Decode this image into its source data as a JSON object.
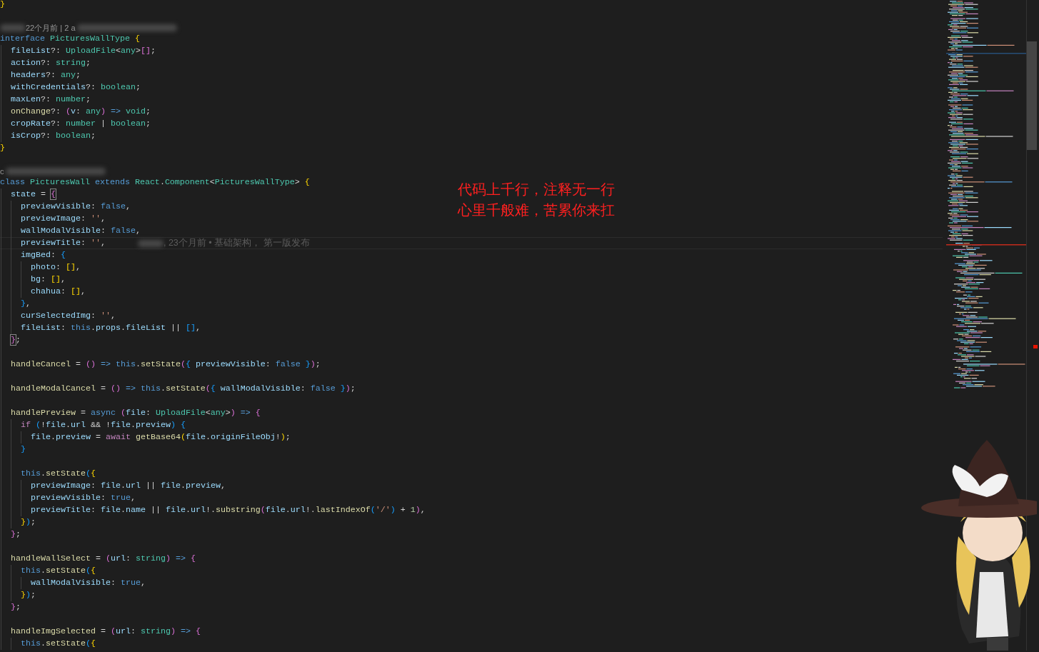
{
  "editor": {
    "lines": [
      {
        "kind": "code",
        "current": false,
        "tokens": [
          {
            "text": "}",
            "kind": "bracket1"
          }
        ]
      },
      {
        "kind": "blank",
        "current": false
      },
      {
        "kind": "lens",
        "segments": [
          {
            "kind": "shortblur"
          },
          {
            "kind": "text",
            "text": "22个月前 | 2 a"
          },
          {
            "kind": "longblur"
          }
        ]
      },
      {
        "kind": "code",
        "current": false,
        "tokens": [
          {
            "text": "interface ",
            "kind": "keyword"
          },
          {
            "text": "PicturesWallType ",
            "kind": "type"
          },
          {
            "text": "{",
            "kind": "bracket1"
          }
        ],
        "children": [
          {
            "kind": "code",
            "current": false,
            "tokens": [
              {
                "text": "fileList",
                "kind": "variable"
              },
              {
                "text": "?: ",
                "kind": "plain"
              },
              {
                "text": "UploadFile",
                "kind": "type"
              },
              {
                "text": "<",
                "kind": "plain"
              },
              {
                "text": "any",
                "kind": "type"
              },
              {
                "text": ">",
                "kind": "plain"
              },
              {
                "text": "[]",
                "kind": "bracket2"
              },
              {
                "text": ";",
                "kind": "plain"
              }
            ]
          },
          {
            "kind": "code",
            "current": false,
            "tokens": [
              {
                "text": "action",
                "kind": "variable"
              },
              {
                "text": "?: ",
                "kind": "plain"
              },
              {
                "text": "string",
                "kind": "type"
              },
              {
                "text": ";",
                "kind": "plain"
              }
            ]
          },
          {
            "kind": "code",
            "current": false,
            "tokens": [
              {
                "text": "headers",
                "kind": "variable"
              },
              {
                "text": "?: ",
                "kind": "plain"
              },
              {
                "text": "any",
                "kind": "type"
              },
              {
                "text": ";",
                "kind": "plain"
              }
            ]
          },
          {
            "kind": "code",
            "current": false,
            "tokens": [
              {
                "text": "withCredentials",
                "kind": "variable"
              },
              {
                "text": "?: ",
                "kind": "plain"
              },
              {
                "text": "boolean",
                "kind": "type"
              },
              {
                "text": ";",
                "kind": "plain"
              }
            ]
          },
          {
            "kind": "code",
            "current": false,
            "tokens": [
              {
                "text": "maxLen",
                "kind": "variable"
              },
              {
                "text": "?: ",
                "kind": "plain"
              },
              {
                "text": "number",
                "kind": "type"
              },
              {
                "text": ";",
                "kind": "plain"
              }
            ]
          },
          {
            "kind": "code",
            "current": false,
            "tokens": [
              {
                "text": "onChange",
                "kind": "function"
              },
              {
                "text": "?: ",
                "kind": "plain"
              },
              {
                "text": "(",
                "kind": "bracket2"
              },
              {
                "text": "v",
                "kind": "variable"
              },
              {
                "text": ": ",
                "kind": "plain"
              },
              {
                "text": "any",
                "kind": "type"
              },
              {
                "text": ")",
                "kind": "bracket2"
              },
              {
                "text": " => ",
                "kind": "keyword"
              },
              {
                "text": "void",
                "kind": "type"
              },
              {
                "text": ";",
                "kind": "plain"
              }
            ]
          },
          {
            "kind": "code",
            "current": false,
            "tokens": [
              {
                "text": "cropRate",
                "kind": "variable"
              },
              {
                "text": "?: ",
                "kind": "plain"
              },
              {
                "text": "number",
                "kind": "type"
              },
              {
                "text": " | ",
                "kind": "plain"
              },
              {
                "text": "boolean",
                "kind": "type"
              },
              {
                "text": ";",
                "kind": "plain"
              }
            ]
          },
          {
            "kind": "code",
            "current": false,
            "tokens": [
              {
                "text": "isCrop",
                "kind": "variable"
              },
              {
                "text": "?: ",
                "kind": "plain"
              },
              {
                "text": "boolean",
                "kind": "type"
              },
              {
                "text": ";",
                "kind": "plain"
              }
            ]
          }
        ]
      },
      {
        "kind": "code",
        "current": false,
        "tokens": [
          {
            "text": "}",
            "kind": "bracket1"
          }
        ]
      },
      {
        "kind": "blank",
        "current": false
      },
      {
        "kind": "lens",
        "segments": [
          {
            "kind": "text",
            "text": "c"
          },
          {
            "kind": "longblur"
          }
        ]
      },
      {
        "kind": "code",
        "current": false,
        "tokens": [
          {
            "text": "class ",
            "kind": "keyword"
          },
          {
            "text": "PicturesWall ",
            "kind": "type"
          },
          {
            "text": "extends ",
            "kind": "keyword"
          },
          {
            "text": "React",
            "kind": "type"
          },
          {
            "text": ".",
            "kind": "plain"
          },
          {
            "text": "Component",
            "kind": "type"
          },
          {
            "text": "<",
            "kind": "plain"
          },
          {
            "text": "PicturesWallType",
            "kind": "type"
          },
          {
            "text": "> ",
            "kind": "plain"
          },
          {
            "text": "{",
            "kind": "bracket1"
          }
        ],
        "children": [
          {
            "kind": "code",
            "current": false,
            "tokens": [
              {
                "text": "state",
                "kind": "variable"
              },
              {
                "text": " = ",
                "kind": "plain"
              },
              {
                "text": "{",
                "kind": "match"
              }
            ],
            "children": [
              {
                "kind": "code",
                "current": false,
                "tokens": [
                  {
                    "text": "previewVisible",
                    "kind": "variable"
                  },
                  {
                    "text": ": ",
                    "kind": "plain"
                  },
                  {
                    "text": "false",
                    "kind": "keyword"
                  },
                  {
                    "text": ",",
                    "kind": "plain"
                  }
                ]
              },
              {
                "kind": "code",
                "current": false,
                "tokens": [
                  {
                    "text": "previewImage",
                    "kind": "variable"
                  },
                  {
                    "text": ": ",
                    "kind": "plain"
                  },
                  {
                    "text": "''",
                    "kind": "string"
                  },
                  {
                    "text": ",",
                    "kind": "plain"
                  }
                ]
              },
              {
                "kind": "code",
                "current": false,
                "tokens": [
                  {
                    "text": "wallModalVisible",
                    "kind": "variable"
                  },
                  {
                    "text": ": ",
                    "kind": "plain"
                  },
                  {
                    "text": "false",
                    "kind": "keyword"
                  },
                  {
                    "text": ",",
                    "kind": "plain"
                  }
                ]
              },
              {
                "kind": "code",
                "current": true,
                "tokens": [
                  {
                    "text": "previewTitle",
                    "kind": "variable"
                  },
                  {
                    "text": ": ",
                    "kind": "plain"
                  },
                  {
                    "text": "''",
                    "kind": "string"
                  },
                  {
                    "text": ",",
                    "kind": "plain"
                  }
                ],
                "blame": [
                  {
                    "kind": "shortblur"
                  },
                  {
                    "kind": "text",
                    "text": ", 23个月前 • 基础架构， 第一版发布"
                  }
                ]
              },
              {
                "kind": "code",
                "current": false,
                "tokens": [
                  {
                    "text": "imgBed",
                    "kind": "variable"
                  },
                  {
                    "text": ": ",
                    "kind": "plain"
                  },
                  {
                    "text": "{",
                    "kind": "bracket3"
                  }
                ],
                "children": [
                  {
                    "kind": "code",
                    "current": false,
                    "tokens": [
                      {
                        "text": "photo",
                        "kind": "variable"
                      },
                      {
                        "text": ": ",
                        "kind": "plain"
                      },
                      {
                        "text": "[]",
                        "kind": "bracket1"
                      },
                      {
                        "text": ",",
                        "kind": "plain"
                      }
                    ]
                  },
                  {
                    "kind": "code",
                    "current": false,
                    "tokens": [
                      {
                        "text": "bg",
                        "kind": "variable"
                      },
                      {
                        "text": ": ",
                        "kind": "plain"
                      },
                      {
                        "text": "[]",
                        "kind": "bracket1"
                      },
                      {
                        "text": ",",
                        "kind": "plain"
                      }
                    ]
                  },
                  {
                    "kind": "code",
                    "current": false,
                    "tokens": [
                      {
                        "text": "chahua",
                        "kind": "variable"
                      },
                      {
                        "text": ": ",
                        "kind": "plain"
                      },
                      {
                        "text": "[]",
                        "kind": "bracket1"
                      },
                      {
                        "text": ",",
                        "kind": "plain"
                      }
                    ]
                  }
                ]
              },
              {
                "kind": "code",
                "current": false,
                "tokens": [
                  {
                    "text": "}",
                    "kind": "bracket3"
                  },
                  {
                    "text": ",",
                    "kind": "plain"
                  }
                ]
              },
              {
                "kind": "code",
                "current": false,
                "tokens": [
                  {
                    "text": "curSelectedImg",
                    "kind": "variable"
                  },
                  {
                    "text": ": ",
                    "kind": "plain"
                  },
                  {
                    "text": "''",
                    "kind": "string"
                  },
                  {
                    "text": ",",
                    "kind": "plain"
                  }
                ]
              },
              {
                "kind": "code",
                "current": false,
                "tokens": [
                  {
                    "text": "fileList",
                    "kind": "variable"
                  },
                  {
                    "text": ": ",
                    "kind": "plain"
                  },
                  {
                    "text": "this",
                    "kind": "keyword"
                  },
                  {
                    "text": ".",
                    "kind": "plain"
                  },
                  {
                    "text": "props",
                    "kind": "variable"
                  },
                  {
                    "text": ".",
                    "kind": "plain"
                  },
                  {
                    "text": "fileList",
                    "kind": "variable"
                  },
                  {
                    "text": " || ",
                    "kind": "plain"
                  },
                  {
                    "text": "[]",
                    "kind": "bracket3"
                  },
                  {
                    "text": ",",
                    "kind": "plain"
                  }
                ]
              }
            ]
          },
          {
            "kind": "code",
            "current": false,
            "tokens": [
              {
                "text": "}",
                "kind": "match"
              },
              {
                "text": ";",
                "kind": "plain"
              }
            ]
          },
          {
            "kind": "blank",
            "current": false
          },
          {
            "kind": "code",
            "current": false,
            "tokens": [
              {
                "text": "handleCancel",
                "kind": "function"
              },
              {
                "text": " = ",
                "kind": "plain"
              },
              {
                "text": "()",
                "kind": "bracket2"
              },
              {
                "text": " => ",
                "kind": "keyword"
              },
              {
                "text": "this",
                "kind": "keyword"
              },
              {
                "text": ".",
                "kind": "plain"
              },
              {
                "text": "setState",
                "kind": "function"
              },
              {
                "text": "(",
                "kind": "bracket2"
              },
              {
                "text": "{",
                "kind": "bracket3"
              },
              {
                "text": " previewVisible",
                "kind": "variable"
              },
              {
                "text": ": ",
                "kind": "plain"
              },
              {
                "text": "false",
                "kind": "keyword"
              },
              {
                "text": " }",
                "kind": "bracket3"
              },
              {
                "text": ")",
                "kind": "bracket2"
              },
              {
                "text": ";",
                "kind": "plain"
              }
            ]
          },
          {
            "kind": "blank",
            "current": false
          },
          {
            "kind": "code",
            "current": false,
            "tokens": [
              {
                "text": "handleModalCancel",
                "kind": "function"
              },
              {
                "text": " = ",
                "kind": "plain"
              },
              {
                "text": "()",
                "kind": "bracket2"
              },
              {
                "text": " => ",
                "kind": "keyword"
              },
              {
                "text": "this",
                "kind": "keyword"
              },
              {
                "text": ".",
                "kind": "plain"
              },
              {
                "text": "setState",
                "kind": "function"
              },
              {
                "text": "(",
                "kind": "bracket2"
              },
              {
                "text": "{",
                "kind": "bracket3"
              },
              {
                "text": " wallModalVisible",
                "kind": "variable"
              },
              {
                "text": ": ",
                "kind": "plain"
              },
              {
                "text": "false",
                "kind": "keyword"
              },
              {
                "text": " }",
                "kind": "bracket3"
              },
              {
                "text": ")",
                "kind": "bracket2"
              },
              {
                "text": ";",
                "kind": "plain"
              }
            ]
          },
          {
            "kind": "blank",
            "current": false
          },
          {
            "kind": "code",
            "current": false,
            "tokens": [
              {
                "text": "handlePreview",
                "kind": "function"
              },
              {
                "text": " = ",
                "kind": "plain"
              },
              {
                "text": "async ",
                "kind": "keyword"
              },
              {
                "text": "(",
                "kind": "bracket2"
              },
              {
                "text": "file",
                "kind": "variable"
              },
              {
                "text": ": ",
                "kind": "plain"
              },
              {
                "text": "UploadFile",
                "kind": "type"
              },
              {
                "text": "<",
                "kind": "plain"
              },
              {
                "text": "any",
                "kind": "type"
              },
              {
                "text": ">",
                "kind": "plain"
              },
              {
                "text": ")",
                "kind": "bracket2"
              },
              {
                "text": " => ",
                "kind": "keyword"
              },
              {
                "text": "{",
                "kind": "bracket2"
              }
            ],
            "children": [
              {
                "kind": "code",
                "current": false,
                "tokens": [
                  {
                    "text": "if ",
                    "kind": "control"
                  },
                  {
                    "text": "(",
                    "kind": "bracket3"
                  },
                  {
                    "text": "!",
                    "kind": "plain"
                  },
                  {
                    "text": "file",
                    "kind": "variable"
                  },
                  {
                    "text": ".",
                    "kind": "plain"
                  },
                  {
                    "text": "url",
                    "kind": "variable"
                  },
                  {
                    "text": " && !",
                    "kind": "plain"
                  },
                  {
                    "text": "file",
                    "kind": "variable"
                  },
                  {
                    "text": ".",
                    "kind": "plain"
                  },
                  {
                    "text": "preview",
                    "kind": "variable"
                  },
                  {
                    "text": ")",
                    "kind": "bracket3"
                  },
                  {
                    "text": " {",
                    "kind": "bracket3"
                  }
                ],
                "children": [
                  {
                    "kind": "code",
                    "current": false,
                    "tokens": [
                      {
                        "text": "file",
                        "kind": "variable"
                      },
                      {
                        "text": ".",
                        "kind": "plain"
                      },
                      {
                        "text": "preview",
                        "kind": "variable"
                      },
                      {
                        "text": " = ",
                        "kind": "plain"
                      },
                      {
                        "text": "await ",
                        "kind": "control"
                      },
                      {
                        "text": "getBase64",
                        "kind": "function"
                      },
                      {
                        "text": "(",
                        "kind": "bracket1"
                      },
                      {
                        "text": "file",
                        "kind": "variable"
                      },
                      {
                        "text": ".",
                        "kind": "plain"
                      },
                      {
                        "text": "originFileObj",
                        "kind": "variable"
                      },
                      {
                        "text": "!",
                        "kind": "plain"
                      },
                      {
                        "text": ")",
                        "kind": "bracket1"
                      },
                      {
                        "text": ";",
                        "kind": "plain"
                      }
                    ]
                  }
                ]
              },
              {
                "kind": "code",
                "current": false,
                "tokens": [
                  {
                    "text": "}",
                    "kind": "bracket3"
                  }
                ]
              },
              {
                "kind": "blank",
                "current": false
              },
              {
                "kind": "code",
                "current": false,
                "tokens": [
                  {
                    "text": "this",
                    "kind": "keyword"
                  },
                  {
                    "text": ".",
                    "kind": "plain"
                  },
                  {
                    "text": "setState",
                    "kind": "function"
                  },
                  {
                    "text": "(",
                    "kind": "bracket3"
                  },
                  {
                    "text": "{",
                    "kind": "bracket1"
                  }
                ],
                "children": [
                  {
                    "kind": "code",
                    "current": false,
                    "tokens": [
                      {
                        "text": "previewImage",
                        "kind": "variable"
                      },
                      {
                        "text": ": ",
                        "kind": "plain"
                      },
                      {
                        "text": "file",
                        "kind": "variable"
                      },
                      {
                        "text": ".",
                        "kind": "plain"
                      },
                      {
                        "text": "url",
                        "kind": "variable"
                      },
                      {
                        "text": " || ",
                        "kind": "plain"
                      },
                      {
                        "text": "file",
                        "kind": "variable"
                      },
                      {
                        "text": ".",
                        "kind": "plain"
                      },
                      {
                        "text": "preview",
                        "kind": "variable"
                      },
                      {
                        "text": ",",
                        "kind": "plain"
                      }
                    ]
                  },
                  {
                    "kind": "code",
                    "current": false,
                    "tokens": [
                      {
                        "text": "previewVisible",
                        "kind": "variable"
                      },
                      {
                        "text": ": ",
                        "kind": "plain"
                      },
                      {
                        "text": "true",
                        "kind": "keyword"
                      },
                      {
                        "text": ",",
                        "kind": "plain"
                      }
                    ]
                  },
                  {
                    "kind": "code",
                    "current": false,
                    "tokens": [
                      {
                        "text": "previewTitle",
                        "kind": "variable"
                      },
                      {
                        "text": ": ",
                        "kind": "plain"
                      },
                      {
                        "text": "file",
                        "kind": "variable"
                      },
                      {
                        "text": ".",
                        "kind": "plain"
                      },
                      {
                        "text": "name",
                        "kind": "variable"
                      },
                      {
                        "text": " || ",
                        "kind": "plain"
                      },
                      {
                        "text": "file",
                        "kind": "variable"
                      },
                      {
                        "text": ".",
                        "kind": "plain"
                      },
                      {
                        "text": "url",
                        "kind": "variable"
                      },
                      {
                        "text": "!.",
                        "kind": "plain"
                      },
                      {
                        "text": "substring",
                        "kind": "function"
                      },
                      {
                        "text": "(",
                        "kind": "bracket2"
                      },
                      {
                        "text": "file",
                        "kind": "variable"
                      },
                      {
                        "text": ".",
                        "kind": "plain"
                      },
                      {
                        "text": "url",
                        "kind": "variable"
                      },
                      {
                        "text": "!.",
                        "kind": "plain"
                      },
                      {
                        "text": "lastIndexOf",
                        "kind": "function"
                      },
                      {
                        "text": "(",
                        "kind": "bracket3"
                      },
                      {
                        "text": "'/'",
                        "kind": "string"
                      },
                      {
                        "text": ")",
                        "kind": "bracket3"
                      },
                      {
                        "text": " + ",
                        "kind": "plain"
                      },
                      {
                        "text": "1",
                        "kind": "number"
                      },
                      {
                        "text": ")",
                        "kind": "bracket2"
                      },
                      {
                        "text": ",",
                        "kind": "plain"
                      }
                    ]
                  }
                ]
              },
              {
                "kind": "code",
                "current": false,
                "tokens": [
                  {
                    "text": "}",
                    "kind": "bracket1"
                  },
                  {
                    "text": ")",
                    "kind": "bracket3"
                  },
                  {
                    "text": ";",
                    "kind": "plain"
                  }
                ]
              }
            ]
          },
          {
            "kind": "code",
            "current": false,
            "tokens": [
              {
                "text": "}",
                "kind": "bracket2"
              },
              {
                "text": ";",
                "kind": "plain"
              }
            ]
          },
          {
            "kind": "blank",
            "current": false
          },
          {
            "kind": "code",
            "current": false,
            "tokens": [
              {
                "text": "handleWallSelect",
                "kind": "function"
              },
              {
                "text": " = ",
                "kind": "plain"
              },
              {
                "text": "(",
                "kind": "bracket2"
              },
              {
                "text": "url",
                "kind": "variable"
              },
              {
                "text": ": ",
                "kind": "plain"
              },
              {
                "text": "string",
                "kind": "type"
              },
              {
                "text": ")",
                "kind": "bracket2"
              },
              {
                "text": " => ",
                "kind": "keyword"
              },
              {
                "text": "{",
                "kind": "bracket2"
              }
            ],
            "children": [
              {
                "kind": "code",
                "current": false,
                "tokens": [
                  {
                    "text": "this",
                    "kind": "keyword"
                  },
                  {
                    "text": ".",
                    "kind": "plain"
                  },
                  {
                    "text": "setState",
                    "kind": "function"
                  },
                  {
                    "text": "(",
                    "kind": "bracket3"
                  },
                  {
                    "text": "{",
                    "kind": "bracket1"
                  }
                ],
                "children": [
                  {
                    "kind": "code",
                    "current": false,
                    "tokens": [
                      {
                        "text": "wallModalVisible",
                        "kind": "variable"
                      },
                      {
                        "text": ": ",
                        "kind": "plain"
                      },
                      {
                        "text": "true",
                        "kind": "keyword"
                      },
                      {
                        "text": ",",
                        "kind": "plain"
                      }
                    ]
                  }
                ]
              },
              {
                "kind": "code",
                "current": false,
                "tokens": [
                  {
                    "text": "}",
                    "kind": "bracket1"
                  },
                  {
                    "text": ")",
                    "kind": "bracket3"
                  },
                  {
                    "text": ";",
                    "kind": "plain"
                  }
                ]
              }
            ]
          },
          {
            "kind": "code",
            "current": false,
            "tokens": [
              {
                "text": "}",
                "kind": "bracket2"
              },
              {
                "text": ";",
                "kind": "plain"
              }
            ]
          },
          {
            "kind": "blank",
            "current": false
          },
          {
            "kind": "code",
            "current": false,
            "tokens": [
              {
                "text": "handleImgSelected",
                "kind": "function"
              },
              {
                "text": " = ",
                "kind": "plain"
              },
              {
                "text": "(",
                "kind": "bracket2"
              },
              {
                "text": "url",
                "kind": "variable"
              },
              {
                "text": ": ",
                "kind": "plain"
              },
              {
                "text": "string",
                "kind": "type"
              },
              {
                "text": ")",
                "kind": "bracket2"
              },
              {
                "text": " => ",
                "kind": "keyword"
              },
              {
                "text": "{",
                "kind": "bracket2"
              }
            ],
            "children": [
              {
                "kind": "code",
                "current": false,
                "tokens": [
                  {
                    "text": "this",
                    "kind": "keyword"
                  },
                  {
                    "text": ".",
                    "kind": "plain"
                  },
                  {
                    "text": "setState",
                    "kind": "function"
                  },
                  {
                    "text": "(",
                    "kind": "bracket3"
                  },
                  {
                    "text": "{",
                    "kind": "bracket1"
                  }
                ]
              }
            ]
          }
        ]
      }
    ]
  },
  "note": {
    "lines": [
      "代码上千行，注释无一行",
      "心里千般难，苦累你来扛"
    ]
  }
}
